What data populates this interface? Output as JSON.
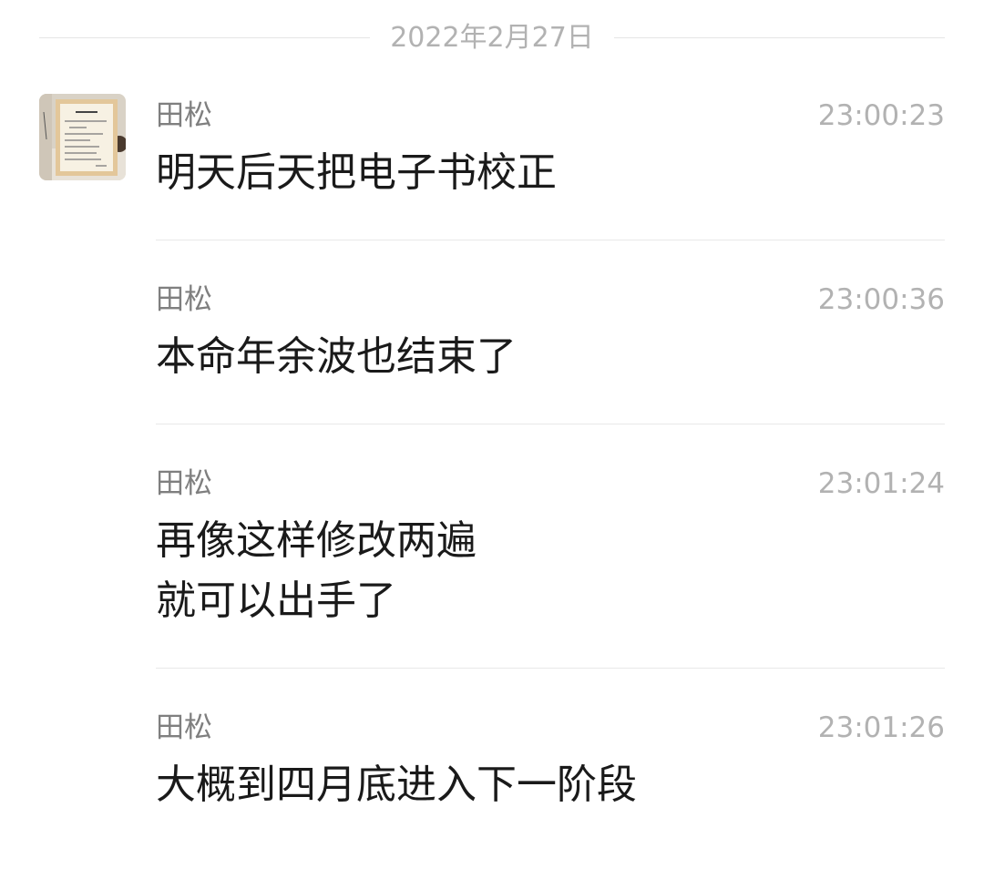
{
  "date_separator": "2022年2月27日",
  "avatar": {
    "icon": "framed-calligraphy-picture-icon"
  },
  "messages": [
    {
      "sender": "田松",
      "time": "23:00:23",
      "text": "明天后天把电子书校正"
    },
    {
      "sender": "田松",
      "time": "23:00:36",
      "text": "本命年余波也结束了"
    },
    {
      "sender": "田松",
      "time": "23:01:24",
      "text": "再像这样修改两遍\n就可以出手了"
    },
    {
      "sender": "田松",
      "time": "23:01:26",
      "text": "大概到四月底进入下一阶段"
    }
  ]
}
